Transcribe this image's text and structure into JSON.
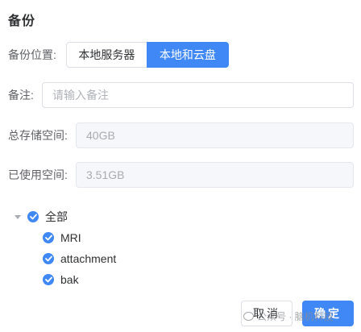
{
  "dialog": {
    "title": "备份"
  },
  "backup_location": {
    "label": "备份位置:",
    "options": [
      "本地服务器",
      "本地和云盘"
    ],
    "selected": "本地和云盘"
  },
  "remark": {
    "label": "备注:",
    "placeholder": "请输入备注",
    "value": ""
  },
  "total_storage": {
    "label": "总存储空间:",
    "value": "40GB"
  },
  "used_storage": {
    "label": "已使用空间:",
    "value": "3.51GB"
  },
  "tree": {
    "root": {
      "label": "全部",
      "checked": true,
      "expanded": true
    },
    "children": [
      {
        "label": "MRI",
        "checked": true
      },
      {
        "label": "attachment",
        "checked": true
      },
      {
        "label": "bak",
        "checked": true
      }
    ]
  },
  "footer": {
    "cancel_label": "取消",
    "confirm_label": "确定"
  },
  "watermark": {
    "text": "公众号 · 脑机科技"
  },
  "colors": {
    "primary": "#3f88f6",
    "border": "#dcdfe6",
    "disabled_bg": "#f5f7fa"
  }
}
